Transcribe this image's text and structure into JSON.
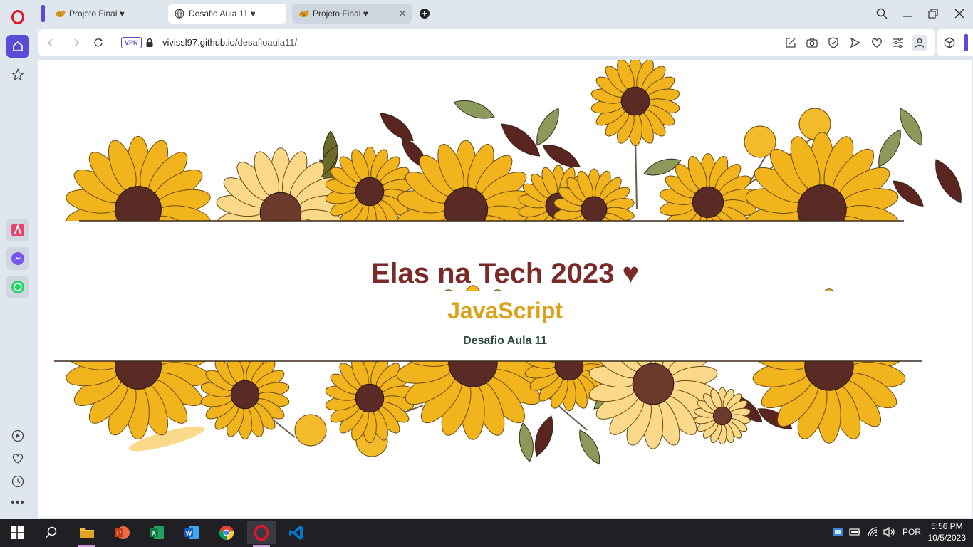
{
  "browser": {
    "tabs": [
      {
        "title": "Projeto Final ♥",
        "active": false
      },
      {
        "title": "Desafio Aula 11 ♥",
        "active": true
      },
      {
        "title": "Projeto Final ♥",
        "active": false
      }
    ],
    "vpn_label": "VPN",
    "url_host": "vivissl97.github.io",
    "url_path": "/desafioaula11/"
  },
  "page": {
    "heading": "Elas na Tech 2023 ♥",
    "subheading": "JavaScript",
    "caption": "Desafio Aula 11"
  },
  "taskbar": {
    "language": "POR",
    "time": "5:56 PM",
    "date": "10/5/2023"
  },
  "colors": {
    "heading": "#7b2a2a",
    "subheading": "#d9a21a",
    "caption": "#2e4a3c",
    "accent": "#5b4bd6",
    "sunflower_petal": "#f2b41c",
    "sunflower_center": "#5a2a24"
  }
}
